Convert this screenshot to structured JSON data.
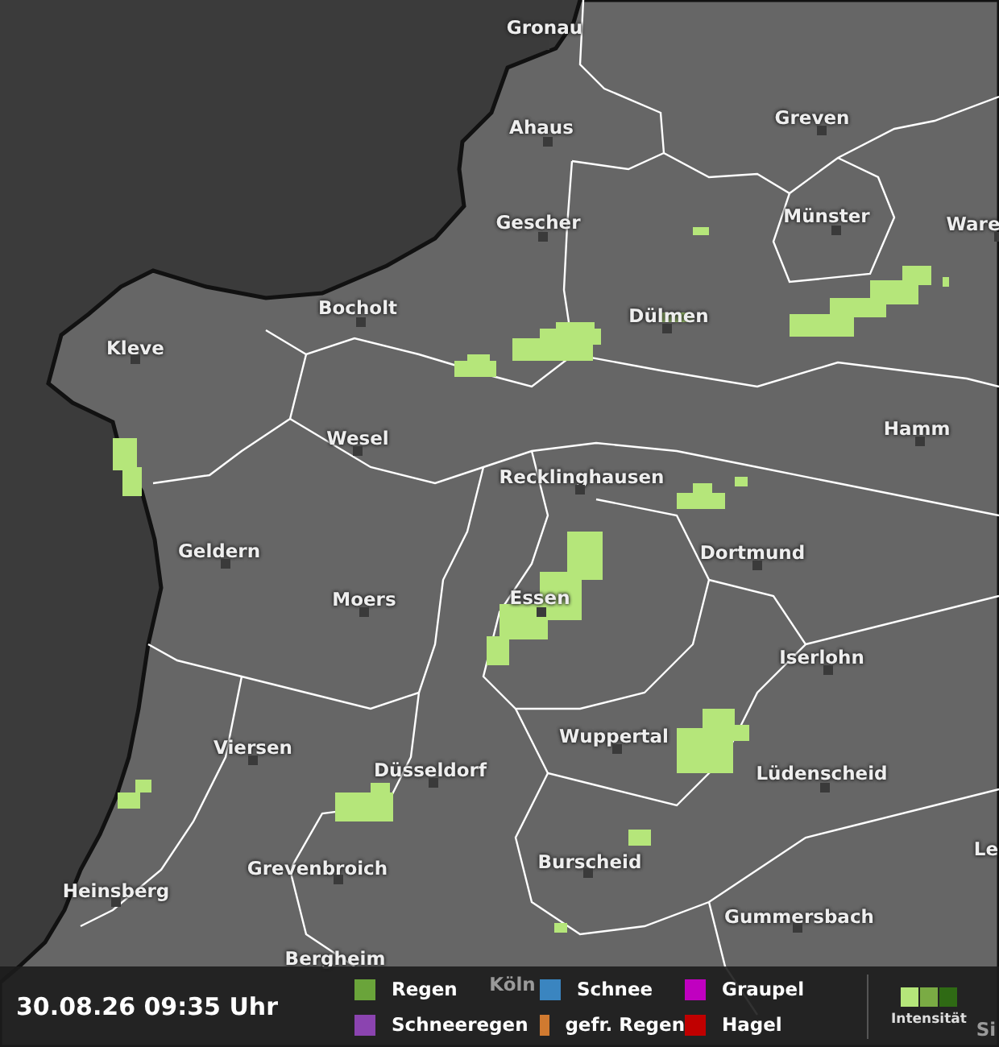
{
  "map": {
    "cities": [
      {
        "name": "Gronau"
      },
      {
        "name": "Ahaus"
      },
      {
        "name": "Greven"
      },
      {
        "name": "Gescher"
      },
      {
        "name": "Münster"
      },
      {
        "name": "Ware"
      },
      {
        "name": "Bocholt"
      },
      {
        "name": "Dülmen"
      },
      {
        "name": "Kleve"
      },
      {
        "name": "Wesel"
      },
      {
        "name": "Hamm"
      },
      {
        "name": "Recklinghausen"
      },
      {
        "name": "Geldern"
      },
      {
        "name": "Dortmund"
      },
      {
        "name": "Moers"
      },
      {
        "name": "Essen"
      },
      {
        "name": "Iserlohn"
      },
      {
        "name": "Viersen"
      },
      {
        "name": "Wuppertal"
      },
      {
        "name": "Lüdenscheid"
      },
      {
        "name": "Düsseldorf"
      },
      {
        "name": "Le"
      },
      {
        "name": "Grevenbroich"
      },
      {
        "name": "Burscheid"
      },
      {
        "name": "Heinsberg"
      },
      {
        "name": "Gummersbach"
      },
      {
        "name": "Bergheim"
      },
      {
        "name": "Köln"
      },
      {
        "name": "Si"
      }
    ]
  },
  "legend": {
    "timestamp": "30.08.26 09:35 Uhr",
    "types": [
      {
        "label": "Regen",
        "color": "#6aa43a"
      },
      {
        "label": "Schnee",
        "color": "#3a85c0"
      },
      {
        "label": "Graupel",
        "color": "#c000c0"
      },
      {
        "label": "Schneeregen",
        "color": "#8b44b0"
      },
      {
        "label": "gefr. Regen",
        "color": "#d07a30"
      },
      {
        "label": "Hagel",
        "color": "#c00000"
      }
    ],
    "intensity": {
      "label": "Intensität",
      "levels": [
        {
          "color": "#b5e67a"
        },
        {
          "color": "#7aab44"
        },
        {
          "color": "#2f6a14"
        }
      ]
    }
  }
}
